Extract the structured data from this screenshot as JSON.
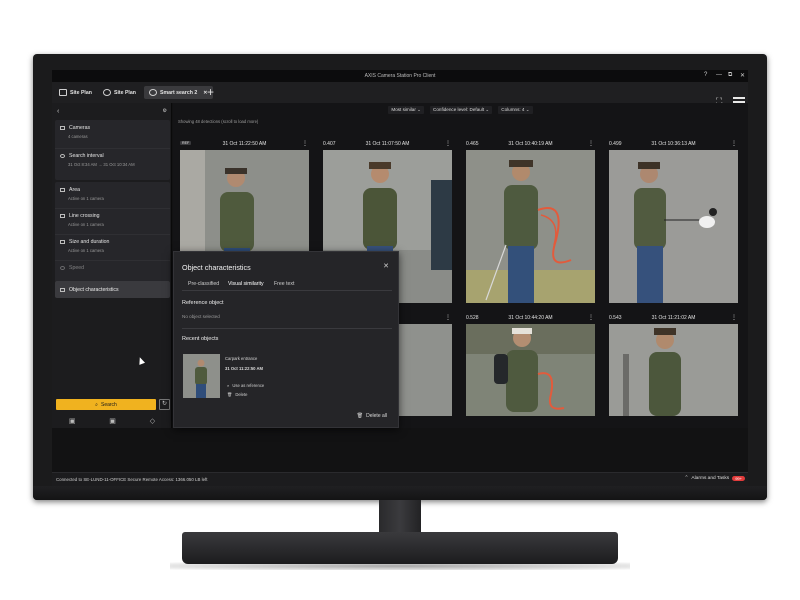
{
  "window": {
    "title": "AXIS Camera Station Pro Client",
    "controls": [
      "?",
      "—",
      "⧉",
      "✕"
    ]
  },
  "tabs": [
    {
      "label": "Site Plan"
    },
    {
      "label": "Site Plan"
    },
    {
      "label": "Smart search 2"
    }
  ],
  "sidebar": {
    "cameras": {
      "label": "Cameras",
      "value": "4 cameras"
    },
    "interval": {
      "label": "Search interval",
      "value": "31 Oct 8:34 AM → 31 Oct 10:34 AM"
    },
    "area": {
      "label": "Area",
      "value": "Active on 1 camera"
    },
    "line": {
      "label": "Line crossing",
      "value": "Active on 1 camera"
    },
    "size": {
      "label": "Size and duration",
      "value": "Active on 1 camera"
    },
    "speed": {
      "label": "Speed"
    },
    "object": {
      "label": "Object characteristics"
    },
    "search_label": "Search"
  },
  "toolbar": {
    "sort": "Most similar",
    "confidence": "Confidence level: Default",
    "columns": "Columns: 4"
  },
  "showing_text": "Showing 48 detections (scroll to load more)",
  "cards": [
    {
      "score": "REF",
      "time": "31 Oct 11:22:50 AM"
    },
    {
      "score": "0.407",
      "time": "31 Oct 11:07:50 AM"
    },
    {
      "score": "0.465",
      "time": "31 Oct 10:40:19 AM"
    },
    {
      "score": "0.499",
      "time": "31 Oct 10:36:13 AM"
    },
    {
      "score": "",
      "time": "AM"
    },
    {
      "score": "0.528",
      "time": "31 Oct 10:44:20 AM"
    },
    {
      "score": "0.543",
      "time": "31 Oct 11:21:02 AM"
    }
  ],
  "popup": {
    "title": "Object characteristics",
    "tabs": [
      "Pre-classified",
      "Visual similarity",
      "Free text"
    ],
    "reference_title": "Reference object",
    "reference_sub": "No object selected",
    "recent_title": "Recent objects",
    "recent_name": "Carpark entrance",
    "recent_time": "31 Oct 11:22:50 AM",
    "use_ref": "Use as reference",
    "delete": "Delete",
    "delete_all": "Delete all"
  },
  "status": {
    "left": "Connected to SE-LUND-11-OFFICE  Secure Remote Access: 1366.050 LB left",
    "right": "Alarms and Tasks",
    "badge": "99+"
  },
  "colors": {
    "accent": "#f0b21f",
    "background": "#121213",
    "panel": "#1c1c1e"
  }
}
